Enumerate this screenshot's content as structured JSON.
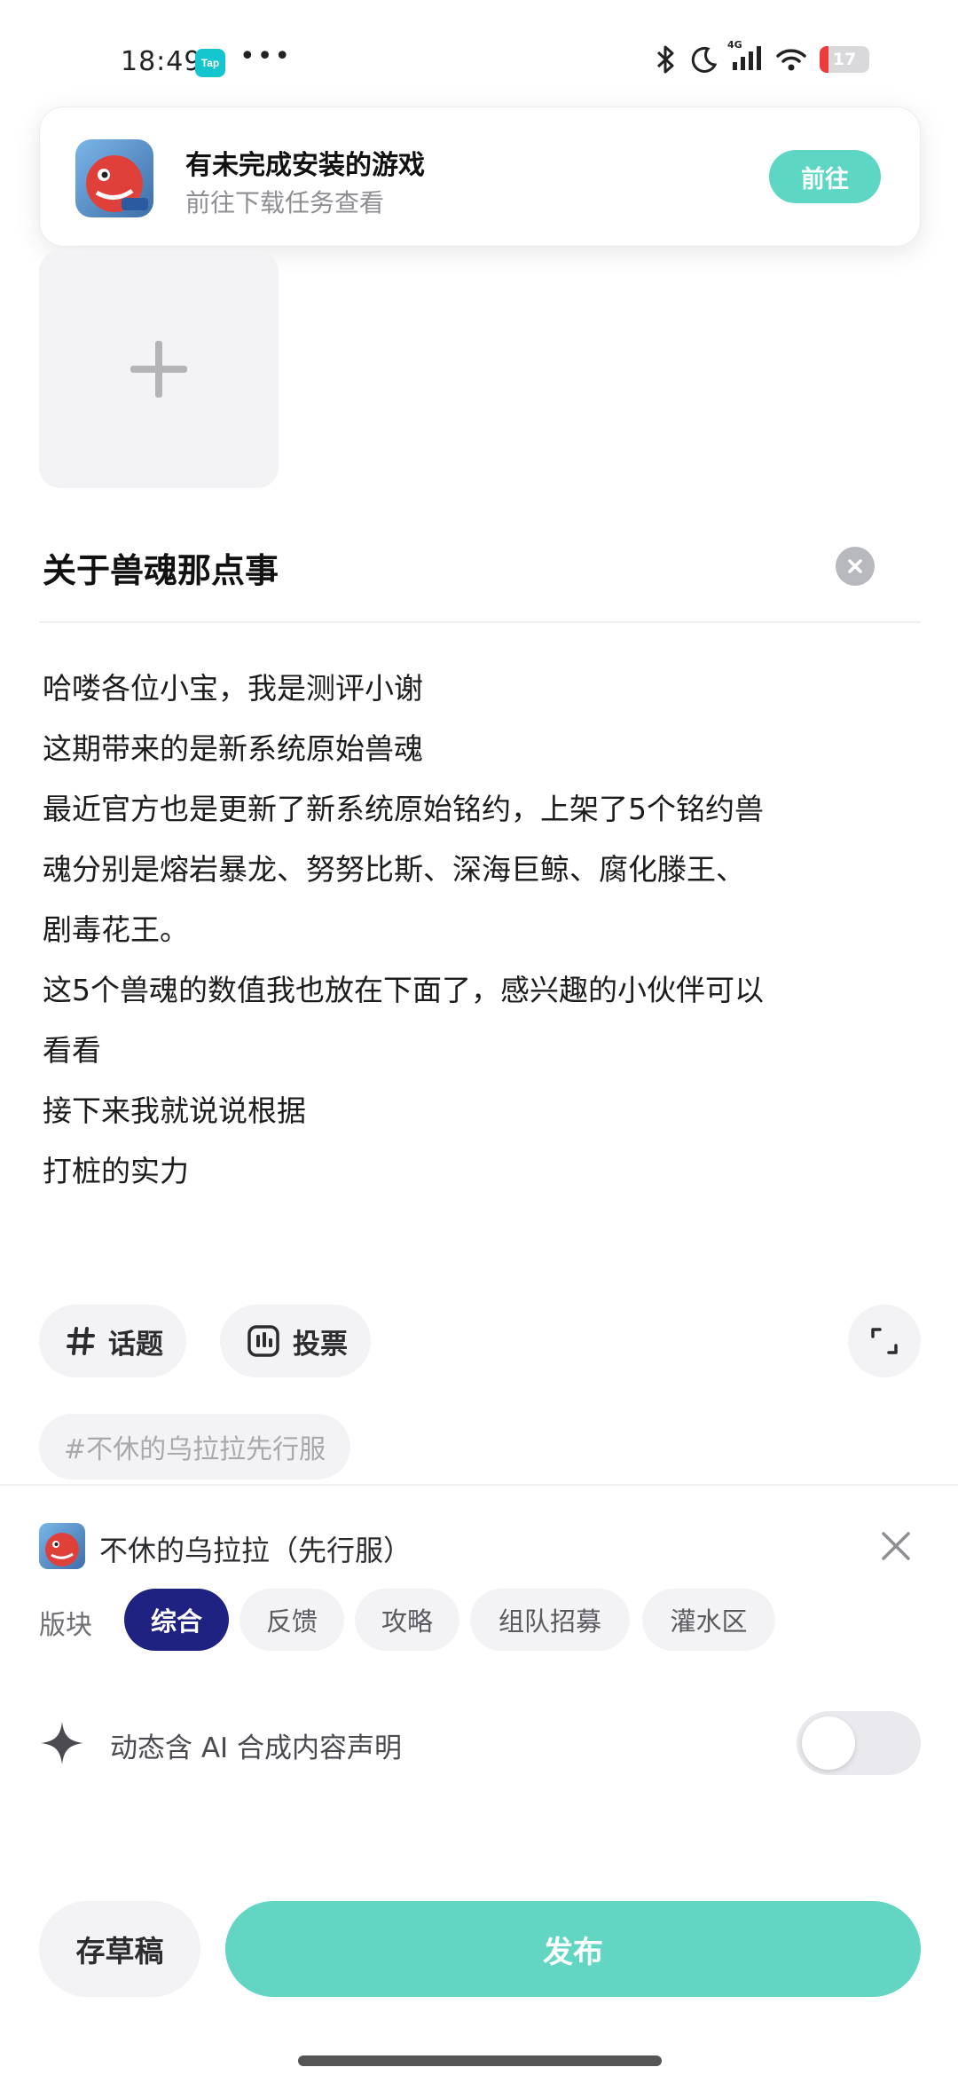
{
  "status_bar": {
    "time": "18:49",
    "tap_badge": "Tap",
    "more": "•••",
    "network_label": "4G",
    "battery": "17"
  },
  "banner": {
    "title": "有未完成安装的游戏",
    "subtitle": "前往下载任务查看",
    "button": "前往",
    "icon": "game-app-icon"
  },
  "post": {
    "title": "关于兽魂那点事",
    "body_lines": [
      "哈喽各位小宝，我是测评小谢",
      "这期带来的是新系统原始兽魂",
      "最近官方也是更新了新系统原始铭约，上架了5个铭约兽",
      "魂分别是熔岩暴龙、努努比斯、深海巨鲸、腐化滕王、",
      "剧毒花王。",
      "这5个兽魂的数值我也放在下面了，感兴趣的小伙伴可以",
      "看看",
      "接下来我就说说根据",
      "打桩的实力"
    ]
  },
  "tools": {
    "topic_label": "话题",
    "vote_label": "投票",
    "tag": "#不休的乌拉拉先行服"
  },
  "game": {
    "name": "不休的乌拉拉（先行服）"
  },
  "board": {
    "label": "版块",
    "options": [
      "综合",
      "反馈",
      "攻略",
      "组队招募",
      "灌水区"
    ],
    "selected": "综合"
  },
  "ai_declaration": {
    "label": "动态含 AI 合成内容声明",
    "enabled": false
  },
  "actions": {
    "draft": "存草稿",
    "publish": "发布"
  },
  "colors": {
    "accent": "#62d6c3",
    "board_active": "#1f2280",
    "battery_low": "#ee3b3b"
  }
}
